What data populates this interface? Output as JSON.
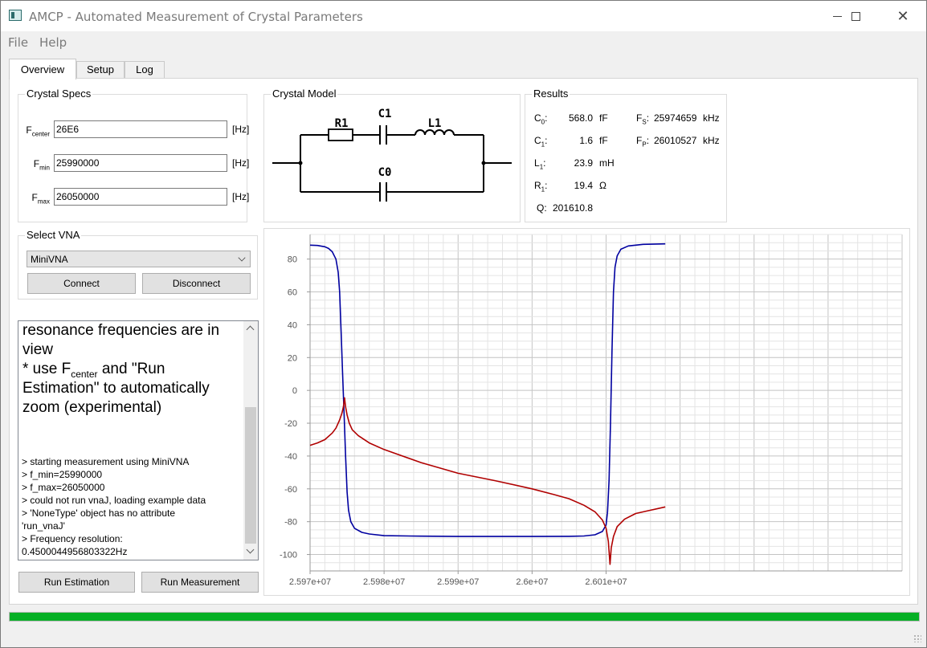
{
  "window": {
    "title": "AMCP - Automated Measurement of Crystal Parameters"
  },
  "menu": {
    "file": "File",
    "help": "Help"
  },
  "tabs": [
    "Overview",
    "Setup",
    "Log"
  ],
  "crystal_specs": {
    "title": "Crystal Specs",
    "fcenter": {
      "label_main": "F",
      "label_sub": "center",
      "value": "26E6",
      "unit": "[Hz]"
    },
    "fmin": {
      "label_main": "F",
      "label_sub": "min",
      "value": "25990000",
      "unit": "[Hz]"
    },
    "fmax": {
      "label_main": "F",
      "label_sub": "max",
      "value": "26050000",
      "unit": "[Hz]"
    }
  },
  "crystal_model": {
    "title": "Crystal Model",
    "labels": {
      "r1": "R1",
      "c1": "C1",
      "l1": "L1",
      "c0": "C0"
    }
  },
  "results": {
    "title": "Results",
    "c0": {
      "m": "C",
      "s": "0",
      "value": "568.0",
      "unit": "fF"
    },
    "c1": {
      "m": "C",
      "s": "1",
      "value": "1.6",
      "unit": "fF"
    },
    "l1": {
      "m": "L",
      "s": "1",
      "value": "23.9",
      "unit": "mH"
    },
    "r1": {
      "m": "R",
      "s": "1",
      "value": "19.4",
      "unit": "Ω"
    },
    "q": {
      "label": "Q:",
      "value": "201610.8"
    },
    "fs": {
      "m": "F",
      "s": "S",
      "value": "25974659",
      "unit": "kHz"
    },
    "fp": {
      "m": "F",
      "s": "P",
      "value": "26010527",
      "unit": "kHz"
    }
  },
  "select_vna": {
    "title": "Select VNA",
    "selected": "MiniVNA",
    "connect": "Connect",
    "disconnect": "Disconnect"
  },
  "log": {
    "big_line1": "resonance frequencies are in",
    "big_line2": "view",
    "big_line3_a": "* use F",
    "big_line3_sub": "center",
    "big_line3_b": " and \"Run",
    "big_line4": "Estimation\" to automatically",
    "big_line5": "zoom (experimental)",
    "lines": [
      "> starting measurement using MiniVNA",
      "> f_min=25990000",
      "> f_max=26050000",
      "> could not run vnaJ, loading example data",
      "> 'NoneType' object has no attribute",
      "'run_vnaJ'",
      "> Frequency resolution:",
      "0.4500044956803322Hz"
    ]
  },
  "actions": {
    "run_estimation": "Run Estimation",
    "run_measurement": "Run Measurement"
  },
  "progress": {
    "value": 1.0,
    "color": "#06b025"
  },
  "colors": {
    "phase": "#0000a0",
    "magnitude": "#b00000",
    "grid": "#d8d8d8"
  },
  "chart_data": {
    "type": "line",
    "xlim": [
      25970000,
      26050000
    ],
    "ylim": [
      -110,
      95
    ],
    "x_ticks": [
      "2.597e+07",
      "2.598e+07",
      "2.599e+07",
      "2.6e+07",
      "2.601e+07"
    ],
    "y_ticks": [
      "80",
      "60",
      "40",
      "20",
      "0",
      "-20",
      "-40",
      "-60",
      "-80",
      "-100"
    ],
    "grid": true,
    "series": [
      {
        "color": "#0000a0",
        "x": [
          25970000,
          25971000,
          25972000,
          25972500,
          25973000,
          25973500,
          25973800,
          25974000,
          25974200,
          25974400,
          25974600,
          25974800,
          25975000,
          25975200,
          25975500,
          25976000,
          25977000,
          25978000,
          25980000,
          25985000,
          25990000,
          25995000,
          26000000,
          26005000,
          26007000,
          26008500,
          26009500,
          26010000,
          26010200,
          26010400,
          26010600,
          26010800,
          26011000,
          26011200,
          26011500,
          26012000,
          26013000,
          26015000,
          26018000
        ],
        "y": [
          88.5,
          88.3,
          87.5,
          86.5,
          84.5,
          80,
          72,
          60,
          35,
          10,
          -15,
          -40,
          -62,
          -73,
          -80,
          -84,
          -86.5,
          -87.5,
          -88.5,
          -88.8,
          -89,
          -89,
          -89,
          -88.9,
          -88.7,
          -88,
          -86,
          -82,
          -74,
          -55,
          -20,
          25,
          60,
          75,
          82,
          86,
          88,
          89,
          89.3
        ]
      },
      {
        "color": "#b00000",
        "x": [
          25970000,
          25971000,
          25972000,
          25973000,
          25973500,
          25974000,
          25974300,
          25974500,
          25974659,
          25974800,
          25975000,
          25975300,
          25975700,
          25976500,
          25978000,
          25980000,
          25985000,
          25990000,
          25995000,
          26000000,
          26003000,
          26005000,
          26007000,
          26008500,
          26009500,
          26010000,
          26010300,
          26010527,
          26010700,
          26011000,
          26011500,
          26012500,
          26014000,
          26016000,
          26018000
        ],
        "y": [
          -33.5,
          -32,
          -30,
          -26,
          -23,
          -18,
          -14,
          -10,
          -4.5,
          -10,
          -15,
          -20,
          -24,
          -27.5,
          -32,
          -36,
          -44,
          -50.5,
          -55,
          -60,
          -63.5,
          -66,
          -70,
          -74,
          -79,
          -84,
          -92,
          -106,
          -96,
          -89,
          -83,
          -78.5,
          -75,
          -73,
          -71
        ]
      }
    ]
  }
}
